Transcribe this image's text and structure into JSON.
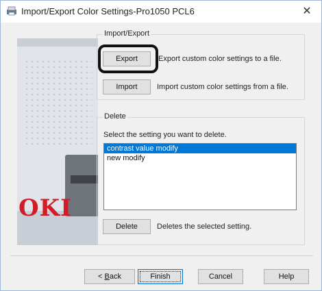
{
  "window": {
    "title": "Import/Export Color Settings-Pro1050 PCL6",
    "close_glyph": "✕"
  },
  "brand": {
    "logo_text": "OKI",
    "logo_color": "#d21c28"
  },
  "import_export": {
    "group_title": "Import/Export",
    "export_button": "Export",
    "export_desc": "Export custom color settings to a file.",
    "import_button": "Import",
    "import_desc": "Import custom color settings from a file."
  },
  "delete_group": {
    "group_title": "Delete",
    "prompt": "Select the setting you want to delete.",
    "items": [
      {
        "label": "contrast value modify",
        "selected": true
      },
      {
        "label": "new modify",
        "selected": false
      }
    ],
    "delete_button": "Delete",
    "delete_desc": "Deletes the selected setting."
  },
  "footer": {
    "back_prefix": "< ",
    "back_mnemonic": "B",
    "back_rest": "ack",
    "finish_label": "Finish",
    "cancel_label": "Cancel",
    "help_label": "Help"
  },
  "colors": {
    "selection": "#0078d7",
    "dialog_bg": "#f0f0f0"
  }
}
